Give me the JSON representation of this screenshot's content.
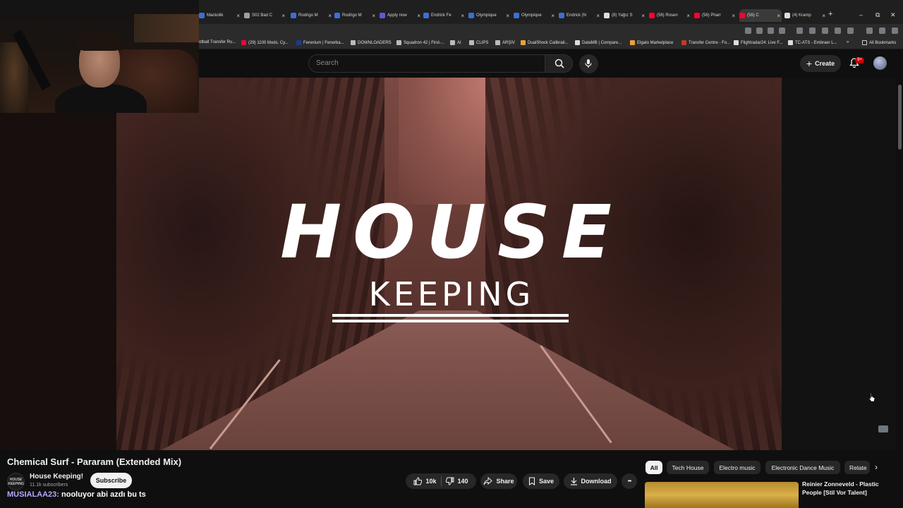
{
  "browser": {
    "tabs": [
      {
        "label": "Mackolik",
        "color": "#3b6fd6"
      },
      {
        "label": "S02 Bad C",
        "color": "#9aa0a6"
      },
      {
        "label": "Rodrigo M",
        "color": "#3b6fd6"
      },
      {
        "label": "Rodrigo M",
        "color": "#3b6fd6"
      },
      {
        "label": "Apply now",
        "color": "#5b5bd6"
      },
      {
        "label": "Endrick Fe",
        "color": "#3b6fd6"
      },
      {
        "label": "Olympique",
        "color": "#3b6fd6"
      },
      {
        "label": "Olympique",
        "color": "#3b6fd6"
      },
      {
        "label": "Endrick (N",
        "color": "#3b6fd6"
      },
      {
        "label": "(8) Yağız S",
        "color": "#dddddd"
      },
      {
        "label": "(56) Rosen",
        "color": "#ff0033"
      },
      {
        "label": "(56) Pharr",
        "color": "#ff0033"
      },
      {
        "label": "(56) C",
        "color": "#ff0033"
      },
      {
        "label": "(4) Kramp",
        "color": "#dddddd"
      }
    ],
    "new_tab": "+",
    "window_controls": {
      "minimize": "–",
      "restore": "⧉",
      "close": "✕"
    },
    "bookmarks": [
      {
        "label": "otball Transfer Ru...",
        "color": "#9aa0a6"
      },
      {
        "label": "(29) 1100 Mods. Cy...",
        "color": "#ff0033"
      },
      {
        "label": "Fenerium | Fenerba...",
        "color": "#1b3b8a"
      },
      {
        "label": "DOWNLOADERS",
        "color": "#bbbbbb"
      },
      {
        "label": "Squadron 42 | First-...",
        "color": "#bbbbbb"
      },
      {
        "label": "AI",
        "color": "#bbbbbb"
      },
      {
        "label": "CLIPS",
        "color": "#bbbbbb"
      },
      {
        "label": "ARŞİV",
        "color": "#bbbbbb"
      },
      {
        "label": "DualShock Calibrati...",
        "color": "#e8a23a"
      },
      {
        "label": "DataMB | Compare...",
        "color": "#dddddd"
      },
      {
        "label": "Elgato Marketplace",
        "color": "#e8a23a"
      },
      {
        "label": "Transfer Centre - Fo...",
        "color": "#c0392b"
      },
      {
        "label": "Flightradar24: Live F...",
        "color": "#dddddd"
      },
      {
        "label": "TC-ATS - Embraer L...",
        "color": "#dddddd"
      }
    ],
    "bookmarks_more": "»",
    "all_bookmarks": "All Bookmarks"
  },
  "youtube": {
    "search_placeholder": "Search",
    "create_label": "Create",
    "notification_badge": "9+",
    "video": {
      "overlay_word1": "HOUSE",
      "overlay_word2": "KEEPING"
    },
    "title": "Chemical Surf - Pararam (Extended Mix)",
    "channel": {
      "name": "House Keeping!",
      "subscribers": "11.1k subscribers",
      "avatar_text": "HOUSE KEEPING"
    },
    "subscribe_label": "Subscribe",
    "actions": {
      "likes": "10k",
      "dislikes": "140",
      "share": "Share",
      "save": "Save",
      "download": "Download",
      "more": "•••"
    },
    "chips": [
      "All",
      "Tech House",
      "Electro music",
      "Electronic Dance Music",
      "Relate"
    ],
    "chips_next": "›",
    "recommendation": {
      "title": "Reinier Zonneveld - Plastic People [Stil Vor Talent]"
    }
  },
  "chat": {
    "user": "MUSIALAA23:",
    "message": "nooluyor abi azdı bu ts"
  },
  "colors": {
    "youtube_red": "#ff0033",
    "chat_user": "#b9a6ff",
    "badge": "#cc0000"
  }
}
